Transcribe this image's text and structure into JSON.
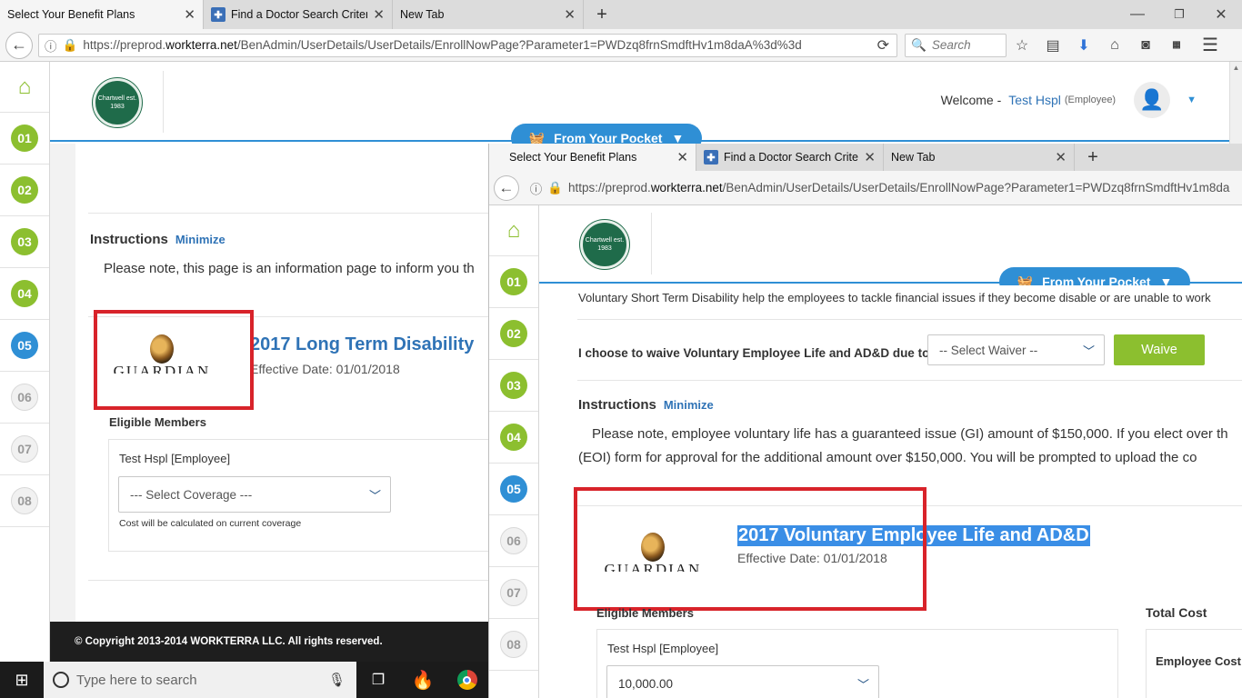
{
  "back_window": {
    "tabs": [
      {
        "title": "Select Your Benefit Plans"
      },
      {
        "title": "Find a Doctor Search Criteria"
      },
      {
        "title": "New Tab"
      }
    ],
    "url_prefix": "https://preprod.",
    "url_domain": "workterra.net",
    "url_path": "/BenAdmin/UserDetails/UserDetails/EnrollNowPage?Parameter1=PWDzq8frnSmdftHv1m8daA%3d%3d",
    "search_placeholder": "Search",
    "welcome_label": "Welcome -",
    "user_name": "Test Hspl",
    "user_role": "(Employee)",
    "pocket_label": "From Your Pocket",
    "instructions_label": "Instructions",
    "minimize_label": "Minimize",
    "instructions_text": "Please note, this page is an information page to inform you th",
    "plan_title": "2017 Long Term Disability",
    "effective_date": "Effective Date: 01/01/2018",
    "eligible_label": "Eligible Members",
    "member_name": "Test Hspl [Employee]",
    "coverage_placeholder": "--- Select Coverage ---",
    "cost_note": "Cost will be calculated on current coverage",
    "copyright": "© Copyright 2013-2014 WORKTERRA LLC. All rights reserved."
  },
  "steps": [
    "01",
    "02",
    "03",
    "04",
    "05",
    "06",
    "07",
    "08"
  ],
  "logo_text": "Chartwell est. 1983",
  "carrier_logo": "GUARDIAN",
  "front_window": {
    "tabs": [
      {
        "title": "Select Your Benefit Plans"
      },
      {
        "title": "Find a Doctor Search Criteria"
      },
      {
        "title": "New Tab"
      }
    ],
    "url_prefix": "https://preprod.",
    "url_domain": "workterra.net",
    "url_path": "/BenAdmin/UserDetails/UserDetails/EnrollNowPage?Parameter1=PWDzq8frnSmdftHv1m8da",
    "pocket_label": "From Your Pocket",
    "intro_text": "Voluntary Short Term Disability help the employees to tackle financial issues if they become disable or are unable to work",
    "waive_question": "I choose to waive Voluntary Employee Life and AD&D due to",
    "waiver_placeholder": "-- Select Waiver --",
    "waive_button": "Waive",
    "instructions_label": "Instructions",
    "minimize_label": "Minimize",
    "instructions_line1": "Please note, employee voluntary life has a guaranteed issue (GI) amount of $150,000. If you elect over th",
    "instructions_line2": "(EOI) form for approval for the additional amount over $150,000. You will be prompted to upload the co",
    "plan_title": "2017 Voluntary Employee Life and AD&D",
    "effective_date": "Effective Date: 01/01/2018",
    "eligible_label": "Eligible Members",
    "total_cost_label": "Total Cost",
    "member_name": "Test Hspl [Employee]",
    "coverage_value": "10,000.00",
    "employee_cost_label": "Employee Cost :"
  },
  "taskbar": {
    "search_placeholder": "Type here to search"
  },
  "colors": {
    "accent_green": "#8cbf2f",
    "accent_blue": "#2f8fd5",
    "highlight_red": "#d8232a",
    "brand_green": "#1f6b4a"
  }
}
